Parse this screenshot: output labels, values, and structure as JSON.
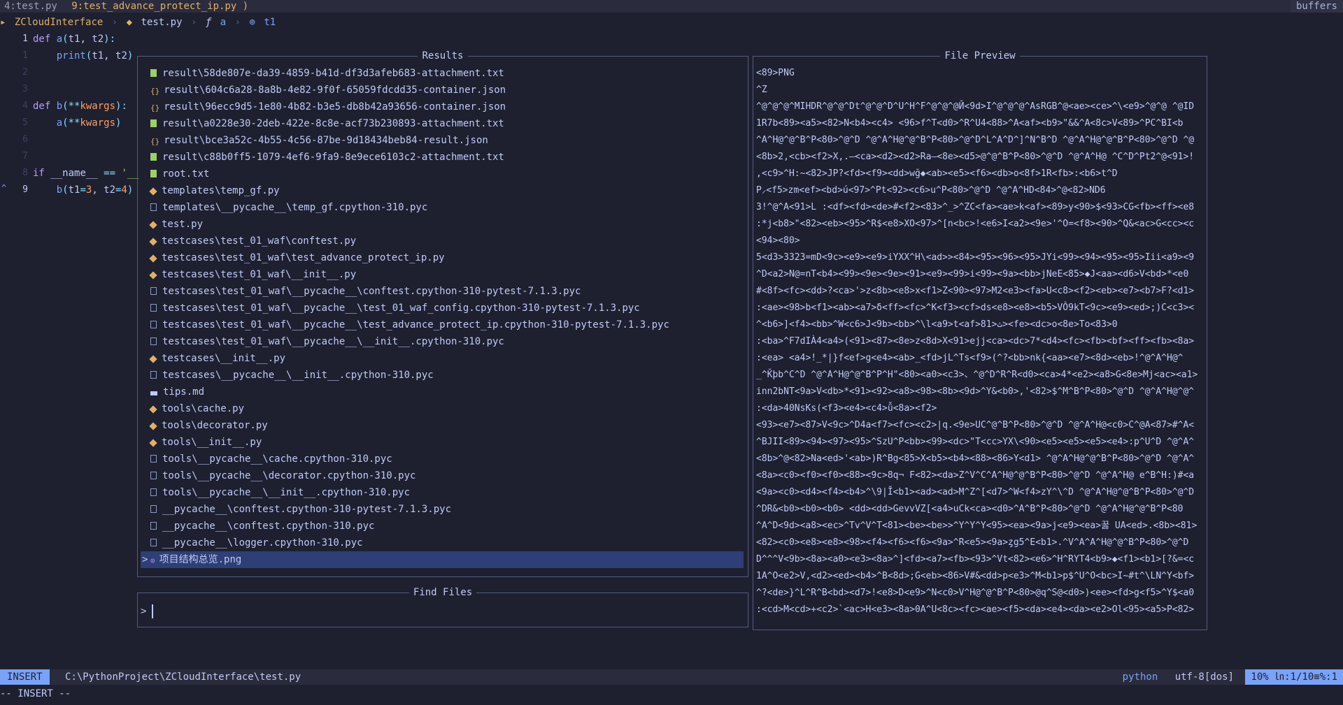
{
  "tabline": {
    "tabs": [
      {
        "label": "4:test.py"
      },
      {
        "label": "9:test_advance_protect_ip.py )"
      }
    ],
    "buffers_label": "buffers"
  },
  "winbar": {
    "project": "ZCloudInterface",
    "file": "test.py",
    "func": "a",
    "symbol": "t1",
    "colors": {
      "project": "#e0af68",
      "file": "#c0caf5",
      "func": "#7aa2f7",
      "symbol": "#7aa2f7"
    }
  },
  "editor": {
    "lines": [
      {
        "num": "1",
        "current": true,
        "tokens": [
          [
            "kw",
            "def "
          ],
          [
            "fn",
            "a"
          ],
          [
            "op",
            "("
          ],
          [
            "",
            "t1, t2"
          ],
          [
            "op",
            "):"
          ]
        ]
      },
      {
        "num": "1",
        "tokens": [
          [
            "",
            "    "
          ],
          [
            "fn",
            "print"
          ],
          [
            "op",
            "("
          ],
          [
            "",
            "t1, t2"
          ],
          [
            "op",
            ")"
          ]
        ]
      },
      {
        "num": "2",
        "tokens": []
      },
      {
        "num": "3",
        "tokens": []
      },
      {
        "num": "4",
        "tokens": [
          [
            "kw",
            "def "
          ],
          [
            "fn",
            "b"
          ],
          [
            "op",
            "(**"
          ],
          [
            "num",
            "kwargs"
          ],
          [
            "op",
            "):"
          ]
        ]
      },
      {
        "num": "5",
        "tokens": [
          [
            "",
            "    "
          ],
          [
            "fn",
            "a"
          ],
          [
            "op",
            "(**"
          ],
          [
            "num",
            "kwargs"
          ],
          [
            "op",
            ")"
          ]
        ]
      },
      {
        "num": "6",
        "tokens": []
      },
      {
        "num": "7",
        "tokens": []
      },
      {
        "num": "8",
        "tokens": [
          [
            "kw",
            "if "
          ],
          [
            "",
            "__name__ "
          ],
          [
            "op",
            "== "
          ],
          [
            "str",
            "'__"
          ]
        ]
      },
      {
        "num": "9",
        "current": true,
        "tokens": [
          [
            "",
            "    "
          ],
          [
            "fn",
            "b"
          ],
          [
            "op",
            "("
          ],
          [
            "",
            "t1"
          ],
          [
            "op",
            "="
          ],
          [
            "num",
            "3"
          ],
          [
            "",
            ", t2"
          ],
          [
            "op",
            "="
          ],
          [
            "num",
            "4"
          ],
          [
            "op",
            ")"
          ]
        ]
      }
    ]
  },
  "telescope": {
    "results_title": "Results",
    "preview_title": "File Preview",
    "prompt_title": "Find Files",
    "prompt_prefix": ">",
    "prompt_value": "",
    "selected_caret": ">",
    "results": [
      {
        "icon": "txt",
        "name": "result\\58de807e-da39-4859-b41d-df3d3afeb683-attachment.txt"
      },
      {
        "icon": "json",
        "name": "result\\604c6a28-8a8b-4e82-9f0f-65059fdcdd35-container.json"
      },
      {
        "icon": "json",
        "name": "result\\96ecc9d5-1e80-4b82-b3e5-db8b42a93656-container.json"
      },
      {
        "icon": "txt",
        "name": "result\\a0228e30-2deb-422e-8c8e-acf73b230893-attachment.txt"
      },
      {
        "icon": "json",
        "name": "result\\bce3a52c-4b55-4c56-87be-9d18434beb84-result.json"
      },
      {
        "icon": "txt",
        "name": "result\\c88b0ff5-1079-4ef6-9fa9-8e9ece6103c2-attachment.txt"
      },
      {
        "icon": "txt",
        "name": "root.txt"
      },
      {
        "icon": "py",
        "name": "templates\\temp_gf.py"
      },
      {
        "icon": "pyc",
        "name": "templates\\__pycache__\\temp_gf.cpython-310.pyc"
      },
      {
        "icon": "py",
        "name": "test.py"
      },
      {
        "icon": "py",
        "name": "testcases\\test_01_waf\\conftest.py"
      },
      {
        "icon": "py",
        "name": "testcases\\test_01_waf\\test_advance_protect_ip.py"
      },
      {
        "icon": "py",
        "name": "testcases\\test_01_waf\\__init__.py"
      },
      {
        "icon": "pyc",
        "name": "testcases\\test_01_waf\\__pycache__\\conftest.cpython-310-pytest-7.1.3.pyc"
      },
      {
        "icon": "pyc",
        "name": "testcases\\test_01_waf\\__pycache__\\test_01_waf_config.cpython-310-pytest-7.1.3.pyc"
      },
      {
        "icon": "pyc",
        "name": "testcases\\test_01_waf\\__pycache__\\test_advance_protect_ip.cpython-310-pytest-7.1.3.pyc"
      },
      {
        "icon": "pyc",
        "name": "testcases\\test_01_waf\\__pycache__\\__init__.cpython-310.pyc"
      },
      {
        "icon": "py",
        "name": "testcases\\__init__.py"
      },
      {
        "icon": "pyc",
        "name": "testcases\\__pycache__\\__init__.cpython-310.pyc"
      },
      {
        "icon": "md",
        "name": "tips.md"
      },
      {
        "icon": "py",
        "name": "tools\\cache.py"
      },
      {
        "icon": "py",
        "name": "tools\\decorator.py"
      },
      {
        "icon": "py",
        "name": "tools\\__init__.py"
      },
      {
        "icon": "pyc",
        "name": "tools\\__pycache__\\cache.cpython-310.pyc"
      },
      {
        "icon": "pyc",
        "name": "tools\\__pycache__\\decorator.cpython-310.pyc"
      },
      {
        "icon": "pyc",
        "name": "tools\\__pycache__\\__init__.cpython-310.pyc"
      },
      {
        "icon": "pyc",
        "name": "__pycache__\\conftest.cpython-310-pytest-7.1.3.pyc"
      },
      {
        "icon": "pyc",
        "name": "__pycache__\\conftest.cpython-310.pyc"
      },
      {
        "icon": "pyc",
        "name": "__pycache__\\logger.cpython-310.pyc"
      },
      {
        "icon": "png",
        "name": "项目结构总览.png",
        "selected": true
      }
    ],
    "preview_lines": [
      "<89>PNG",
      "^Z",
      "^@^@^@^MIHDR^@^@^Dt^@^@^D^U^H^F^@^@^@Й<9d>I^@^@^@^AsRGB^@<ae><ce>^\\<e9>^@^@ ^@ID",
      "1R7b<89><a5><82>N<b4><c4>   <96>f^T<d0>^R^U4<88>^A<af><b9>\"&&^A<8c>V<89>^PC^BI<b",
      "^A^H@^@^B^P<80>^@^D ^@^A^H@^@^B^P<80>^@^D^L^A^D^]^N^B^D ^@^A^H@^@^B^P<80>^@^D ^@",
      "<8b>2,<cb><f2>X,.—<ca><d2><d2>Ra—<8e><d5>@^@^B^P<80>^@^D ^@^A^H@ ^C^D^Pt2^@<91>!",
      ",<c9>^H:~<82>JP?<fd><f9><dd>wğ◆<ab><e5><f6><db>o<8f>1R<fb>:<b6>t^D",
      "P⸝<f5>zm<ef><bd>ú<97>^Pt<92><c6>u^P<80>^@^D ^@^A^HD<84>^@<82>ND6",
      "3!^@^A<91>L :<df><fd><de>#<f2><83>^_>^ZC<fa><ae>k<af><89>y<90>$<93>CG<fb><ff><e8",
      ":*j<b8>\"<82><eb><95>^R$<e8>XO<97>^[n<bc>!<e6>I<a2><9e>'^O=<f8><90>^Q&<ac>G<cc><c",
      "<94><80>",
      "5<d3>3323=mD<9c><e9><e9>iYXX^H\\<ad>><84><95><96><95>JYi<99><94><95><95>Iii<a9><9",
      "^D<a2>N@=nT<b4><99><9e><9e><91><e9><99>i<99><9a><bb>jNeE<85>◆J<aa><d6>V<bd>*<e0",
      "#<8f><fc><dd>?<ca>'>z<8b><e8>x<f1>Z<90><97>M2<e3><fa>U<c8><f2><eb><e7><b7>F?<d1>",
      ":<ae><98>b<f1><ab><a7>δ<ff><fc>^K<f3><cf>ds<e8><e8><b5>VÔ9kT<9c><e9><ed>;)C<c3><",
      "^<b6>]<f4><bb>^W<c6>J<9b><bb>^\\l<a9>t<af>ث<81><fe><dc>o<8e>To<83>0",
      ":<ba>^F7dIÀ4<a4>(<91><87><8e>z<8d>X<91>ejj<ca><dc>7*<d4><fc><fb><bf><ff><fb><8a>",
      ":<ea>   <a4>!_*|}f<ef>g<e4><ab>_<fd>jL^Ts<f9>(^?<bb>nk{<aa><e7><8d><eb>!^@^A^H@^",
      "_^Ǩþb^C^D ^@^A^H@^@^B^P^H\"<80><a0><c3>、^@^D^R^R<d0><ca>4*<e2><a8>G<8e>Mj<ac><a1>",
      "inn2bNT<9a>V<db>*<91><92><a8><98><8b><9d>^Y&<b0>,'<82>$^M^B^P<80>^@^D ^@^A^H@^@^",
      ":<da>40NsKs(<f3><e4><c4>ǚ<8a><f2>",
      "<93><e7><87>V<9c>^D4a<f7><fc><c2>|q.<9e>UC^@^B^P<80>^@^D ^@^A^H@<c0>C^@A<87>#^A<",
      "^BJII<89><94><97><95>^SzU^P<bb><99><dc>\"T<cc>YX\\<90><e5><e5><e5><e4>:p^U^D ^@^A^",
      "<8b>^@<82>Na<ed>'<ab>)R^Bg<85>X<b5><b4><88><86>Y<d1> ^@^A^H@^@^B^P<80>^@^D ^@^A^",
      "<8a><c0><f0><f0><88><9c>8q¬ F<82><da>Z^V^C^A^H@^@^B^P<80>^@^D ^@^A^H@ e^B^H:)#<a",
      "<9a><c0><d4><f4><b4>^\\9|Ĭ<b1><ad><ad>M^Z^[<d7>^W<f4>zY^\\^D ^@^A^H@^@^B^P<80>^@^D",
      "^DR&<b0><b0><b0> <dd><dd>GevvVZ[<a4>uCk<ca><d0>^A^B^P<80>^@^D ^@^A^H@^@^B^P<80",
      "^A^D<9d><a8><ec>^Tv^V^T<81><be><be>>^Y^Y^Y<95><ea><9a>j<e9><ea>꿇 UA<ed>.<8b><81>",
      "<82><c0><e8><e8><98><f4><f6><f6><9a>^R<e5><9a>ȥg5^E<b1>.^V^A^A^H@^@^B^P<80>^@^D",
      "D^^^V<9b><8a><a0><e3><8a>^]<fd><a7><fb><93>^Vt<82><e6>^H^RYT4<b9>◆<f1><b1>[?&=<c",
      "1A^O<e2>V,<d2><ed><b4>^B<8d>;G<eb><86>V#&<dd>p<e3>^M<b1>p$^U^O<bc>I~#t^\\LN^Y<bf>",
      "^?<de>}^L^R^B<bd><d7>!<e8>D<e9>^N<c0>V^H@^@^B^P<80>@q^S@<d0>)<ee><fd>g<f5>^Y$<a0",
      ":<cd>M<cd>+<c2>`<ac>H<e3><8a>0A^U<8c><fc><ae><f5><da><e4><da><e2>Ol<95><a5>P<82>"
    ]
  },
  "status": {
    "mode": "INSERT",
    "path": "C:\\PythonProject\\ZCloudInterface\\test.py",
    "filetype": "python",
    "encoding": "utf-8[dos]",
    "position": "10% ㏑:1/10≡%:1"
  },
  "cmdline": "-- INSERT --"
}
